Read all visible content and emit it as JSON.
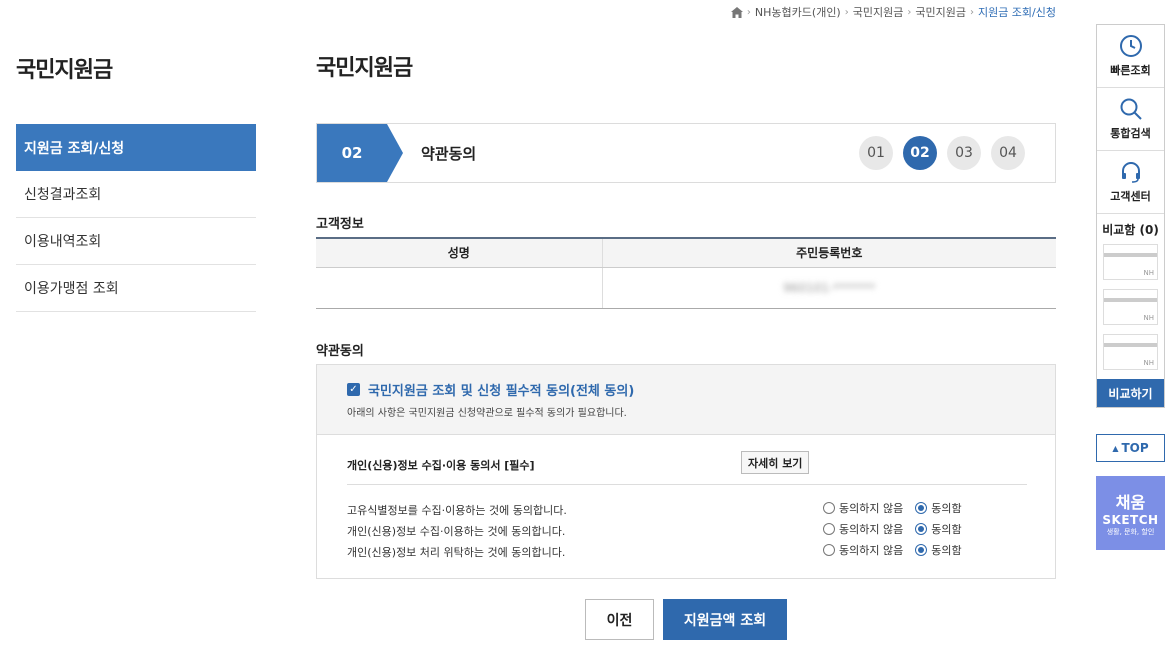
{
  "breadcrumb": {
    "items": [
      "NH농협카드(개인)",
      "국민지원금",
      "국민지원금"
    ],
    "current": "지원금 조회/신청"
  },
  "sidebar": {
    "title": "국민지원금",
    "items": [
      {
        "label": "지원금 조회/신청"
      },
      {
        "label": "신청결과조회"
      },
      {
        "label": "이용내역조회"
      },
      {
        "label": "이용가맹점 조회"
      }
    ]
  },
  "main": {
    "title": "국민지원금",
    "step": {
      "current_num": "02",
      "current_label": "약관동의",
      "steps": [
        "01",
        "02",
        "03",
        "04"
      ]
    },
    "customer_info": {
      "title": "고객정보",
      "headers": [
        "성명",
        "주민등록번호"
      ],
      "values": [
        "",
        "960101-*******"
      ]
    },
    "terms": {
      "title": "약관동의",
      "all_agree_label": "국민지원금 조회 및 신청 필수적 동의(전체 동의)",
      "all_agree_desc": "아래의 사항은 국민지원금 신청약관으로 필수적 동의가 필요합니다.",
      "consent_title": "개인(신용)정보 수집·이용 동의서 [필수]",
      "detail_button": "자세히 보기",
      "disagree_label": "동의하지 않음",
      "agree_label": "동의함",
      "items": [
        {
          "text": "고유식별정보를 수집·이용하는 것에 동의합니다."
        },
        {
          "text": "개인(신용)정보 수집·이용하는 것에 동의합니다."
        },
        {
          "text": "개인(신용)정보 처리 위탁하는 것에 동의합니다."
        }
      ]
    },
    "buttons": {
      "prev": "이전",
      "next": "지원금액 조회"
    }
  },
  "quick_menu": {
    "items": [
      {
        "label": "빠른조회",
        "icon": "clock-icon"
      },
      {
        "label": "통합검색",
        "icon": "search-icon"
      },
      {
        "label": "고객센터",
        "icon": "headset-icon"
      }
    ],
    "compare_title": "비교함 (0)",
    "compare_slot_label": "NH",
    "compare_button": "비교하기",
    "top_button": "TOP",
    "banner": {
      "line1": "채움",
      "line2": "SKETCH",
      "line3": "생활, 문화, 할인"
    }
  },
  "colors": {
    "accent": "#2f69ad",
    "accent_light": "#3a78bd",
    "banner": "#7c8fe6"
  }
}
